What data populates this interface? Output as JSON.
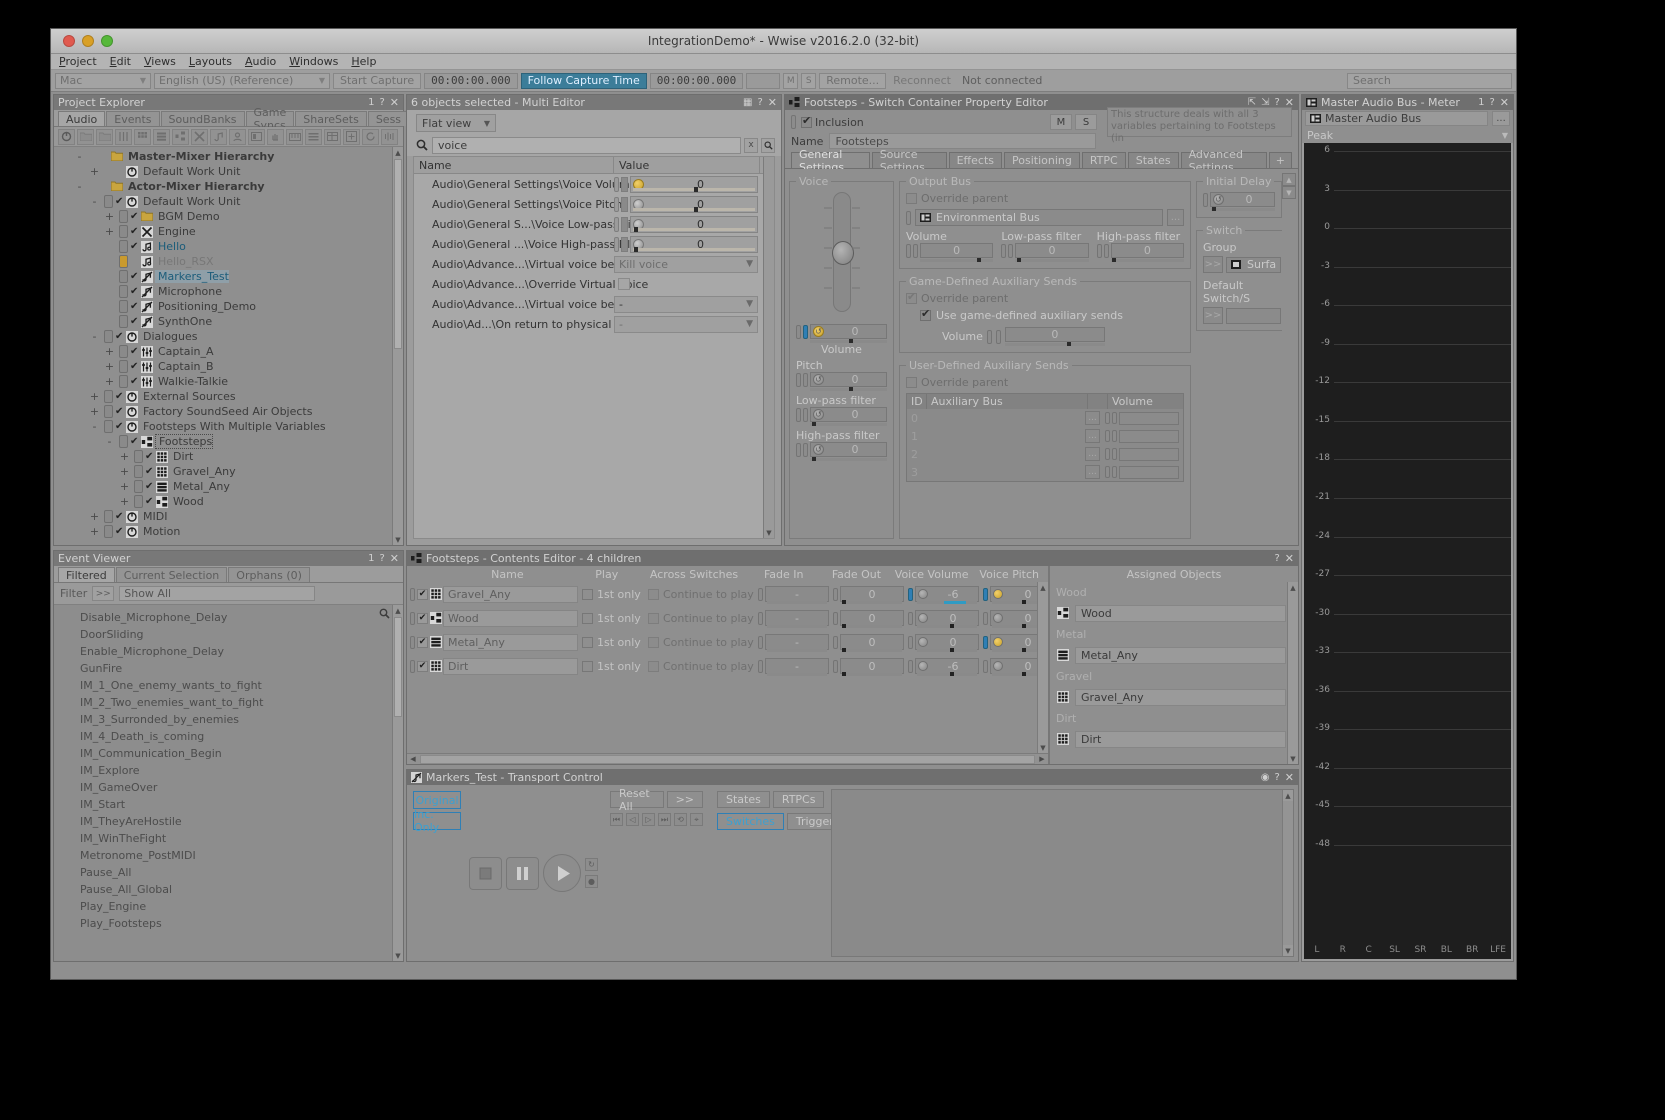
{
  "window": {
    "title": "IntegrationDemo* - Wwise v2016.2.0 (32-bit)"
  },
  "menubar": {
    "items": [
      "Project",
      "Edit",
      "Views",
      "Layouts",
      "Audio",
      "Windows",
      "Help"
    ]
  },
  "toolbar": {
    "platform": "Mac",
    "language": "English (US) (Reference)",
    "start_capture": "Start Capture",
    "time_1": "00:00:00.000",
    "follow_capture_time": "Follow Capture Time",
    "time_2": "00:00:00.000",
    "mute": "M",
    "solo": "S",
    "remote": "Remote...",
    "reconnect": "Reconnect",
    "status": "Not connected",
    "search_placeholder": "Search"
  },
  "project_explorer": {
    "title": "Project Explorer",
    "badge": "1",
    "tabs": [
      "Audio",
      "Events",
      "SoundBanks",
      "Game Syncs",
      "ShareSets",
      "Sess"
    ],
    "selected_tab": "Audio",
    "tree": [
      {
        "label": "Master-Mixer Hierarchy",
        "depth": 0,
        "expander": "-",
        "icon": "folder-icon",
        "style": "bold",
        "check": false
      },
      {
        "label": "Default Work Unit",
        "depth": 1,
        "expander": "+",
        "icon": "workunit-icon",
        "style": "normal",
        "check": false
      },
      {
        "label": "Actor-Mixer Hierarchy",
        "depth": 0,
        "expander": "-",
        "icon": "folder-icon",
        "style": "bold",
        "check": false
      },
      {
        "label": "Default Work Unit",
        "depth": 1,
        "expander": "-",
        "icon": "workunit-icon",
        "style": "normal",
        "check": true
      },
      {
        "label": "BGM Demo",
        "depth": 2,
        "expander": "+",
        "icon": "folder-icon",
        "style": "normal",
        "check": true
      },
      {
        "label": "Engine",
        "depth": 2,
        "expander": "+",
        "icon": "blend-icon",
        "style": "normal",
        "check": true
      },
      {
        "label": "Hello",
        "depth": 2,
        "expander": "",
        "icon": "sound-icon",
        "style": "blue",
        "check": true
      },
      {
        "label": "Hello_RSX",
        "depth": 2,
        "expander": "",
        "icon": "sound-icon",
        "style": "dim",
        "check": "amber"
      },
      {
        "label": "Markers_Test",
        "depth": 2,
        "expander": "",
        "icon": "music-icon",
        "style": "highlight",
        "check": true
      },
      {
        "label": "Microphone",
        "depth": 2,
        "expander": "",
        "icon": "music-icon",
        "style": "normal",
        "check": true
      },
      {
        "label": "Positioning_Demo",
        "depth": 2,
        "expander": "",
        "icon": "music-icon",
        "style": "normal",
        "check": true
      },
      {
        "label": "SynthOne",
        "depth": 2,
        "expander": "",
        "icon": "music-icon",
        "style": "normal",
        "check": true
      },
      {
        "label": "Dialogues",
        "depth": 1,
        "expander": "-",
        "icon": "workunit-icon",
        "style": "normal",
        "check": true
      },
      {
        "label": "Captain_A",
        "depth": 2,
        "expander": "+",
        "icon": "mixer-icon",
        "style": "normal",
        "check": true
      },
      {
        "label": "Captain_B",
        "depth": 2,
        "expander": "+",
        "icon": "mixer-icon",
        "style": "normal",
        "check": true
      },
      {
        "label": "Walkie-Talkie",
        "depth": 2,
        "expander": "+",
        "icon": "mixer-icon",
        "style": "normal",
        "check": true
      },
      {
        "label": "External Sources",
        "depth": 1,
        "expander": "+",
        "icon": "workunit-icon",
        "style": "normal",
        "check": true
      },
      {
        "label": "Factory SoundSeed Air Objects",
        "depth": 1,
        "expander": "+",
        "icon": "workunit-icon",
        "style": "normal",
        "check": true
      },
      {
        "label": "Footsteps With Multiple Variables",
        "depth": 1,
        "expander": "-",
        "icon": "workunit-icon",
        "style": "normal",
        "check": true
      },
      {
        "label": "Footsteps",
        "depth": 2,
        "expander": "-",
        "icon": "switch-icon",
        "style": "dashed",
        "check": true
      },
      {
        "label": "Dirt",
        "depth": 3,
        "expander": "+",
        "icon": "random-icon",
        "style": "normal",
        "check": true
      },
      {
        "label": "Gravel_Any",
        "depth": 3,
        "expander": "+",
        "icon": "random-icon",
        "style": "normal",
        "check": true
      },
      {
        "label": "Metal_Any",
        "depth": 3,
        "expander": "+",
        "icon": "seq-icon",
        "style": "normal",
        "check": true
      },
      {
        "label": "Wood",
        "depth": 3,
        "expander": "+",
        "icon": "switch-icon",
        "style": "normal",
        "check": true
      },
      {
        "label": "MIDI",
        "depth": 1,
        "expander": "+",
        "icon": "workunit-icon",
        "style": "normal",
        "check": true
      },
      {
        "label": "Motion",
        "depth": 1,
        "expander": "+",
        "icon": "workunit-icon",
        "style": "normal",
        "check": true
      }
    ]
  },
  "event_viewer": {
    "title": "Event Viewer",
    "badge": "1",
    "tabs": [
      "Filtered",
      "Current Selection",
      "Orphans (0)"
    ],
    "selected_tab": "Filtered",
    "filter_label": "Filter",
    "filter_button": ">>",
    "filter_value": "Show All",
    "items": [
      "Disable_Microphone_Delay",
      "DoorSliding",
      "Enable_Microphone_Delay",
      "GunFire",
      "IM_1_One_enemy_wants_to_fight",
      "IM_2_Two_enemies_want_to_fight",
      "IM_3_Surronded_by_enemies",
      "IM_4_Death_is_coming",
      "IM_Communication_Begin",
      "IM_Explore",
      "IM_GameOver",
      "IM_Start",
      "IM_TheyAreHostile",
      "IM_WinTheFight",
      "Metronome_PostMIDI",
      "Pause_All",
      "Pause_All_Global",
      "Play_Engine",
      "Play_Footsteps"
    ]
  },
  "multi_editor": {
    "title": "6 objects selected - Multi Editor",
    "view_mode": "Flat view",
    "search_value": "voice",
    "clear_button": "x",
    "columns": [
      "Name",
      "Value"
    ],
    "rows": [
      {
        "name": "Audio\\General Settings\\Voice Volume",
        "type": "slider",
        "value": "0",
        "reset_color": "amber",
        "knob_pct": 50
      },
      {
        "name": "Audio\\General Settings\\Voice Pitch",
        "type": "slider",
        "value": "0",
        "reset_color": "grey",
        "knob_pct": 50
      },
      {
        "name": "Audio\\General S...\\Voice Low-pass Filter",
        "type": "slider",
        "value": "0",
        "reset_color": "grey",
        "knob_pct": 2
      },
      {
        "name": "Audio\\General ...\\Voice High-pass Filter",
        "type": "slider",
        "value": "0",
        "reset_color": "grey",
        "knob_pct": 2
      },
      {
        "name": "Audio\\Advance...\\Virtual voice behavior",
        "type": "select-disabled",
        "value": "Kill voice"
      },
      {
        "name": "Audio\\Advance...\\Override Virtual Voice",
        "type": "checkbox",
        "value": ""
      },
      {
        "name": "Audio\\Advance...\\Virtual voice behavior",
        "type": "select",
        "value": "-"
      },
      {
        "name": "Audio\\Ad...\\On return to physical voice",
        "type": "select-disabled",
        "value": "-"
      }
    ]
  },
  "property_editor": {
    "title": "Footsteps - Switch Container Property Editor",
    "inclusion_label": "Inclusion",
    "mute": "M",
    "solo": "S",
    "note": "This structure deals with all 3 variables pertaining to Footsteps (in",
    "name_label": "Name",
    "name_value": "Footsteps",
    "tabs": [
      "General Settings",
      "Source Settings",
      "Effects",
      "Positioning",
      "RTPC",
      "States",
      "Advanced Settings"
    ],
    "selected_tab": "General Settings",
    "tab_plus": "+",
    "voice": {
      "legend": "Voice",
      "volume_label": "Volume",
      "volume_value": "0",
      "pitch_label": "Pitch",
      "pitch_value": "0",
      "lowpass_label": "Low-pass filter",
      "lowpass_value": "0",
      "highpass_label": "High-pass filter",
      "highpass_value": "0"
    },
    "output_bus": {
      "legend": "Output Bus",
      "override_parent": "Override parent",
      "bus_name": "Environmental Bus",
      "dots": "...",
      "volume_label": "Volume",
      "volume_value": "0",
      "lowpass_label": "Low-pass filter",
      "lowpass_value": "0",
      "highpass_label": "High-pass filter",
      "highpass_value": "0"
    },
    "game_aux": {
      "legend": "Game-Defined Auxiliary Sends",
      "override_parent": "Override parent",
      "use_label": "Use game-defined auxiliary sends",
      "volume_label": "Volume",
      "volume_value": "0"
    },
    "user_aux": {
      "legend": "User-Defined Auxiliary Sends",
      "override_parent": "Override parent",
      "columns": [
        "ID",
        "Auxiliary Bus",
        "Volume"
      ],
      "rows": [
        {
          "id": "0",
          "bus": "",
          "dots": "...",
          "volume": ""
        },
        {
          "id": "1",
          "bus": "",
          "dots": "...",
          "volume": ""
        },
        {
          "id": "2",
          "bus": "",
          "dots": "...",
          "volume": ""
        },
        {
          "id": "3",
          "bus": "",
          "dots": "...",
          "volume": ""
        }
      ]
    },
    "initial_delay": {
      "legend": "Initial Delay",
      "value": "0"
    },
    "switch": {
      "legend": "Switch",
      "group_label": "Group",
      "group_button": ">>",
      "group_value": "Surfa",
      "default_label": "Default Switch/S",
      "default_button": ">>",
      "default_value": ""
    }
  },
  "contents_editor": {
    "title": "Footsteps - Contents Editor - 4 children",
    "columns": [
      "Name",
      "Play",
      "Across Switches",
      "Fade In",
      "Fade Out",
      "Voice Volume",
      "Voice Pitch"
    ],
    "rows": [
      {
        "name": "Gravel_Any",
        "icon": "random-icon",
        "play": "1st only",
        "across": "Continue to play",
        "fade_in": "-",
        "fade_out": "0",
        "voice_volume": "-6",
        "voice_pitch": "0",
        "vol_highlight": true,
        "pitch_amber": true
      },
      {
        "name": "Wood",
        "icon": "switch-icon",
        "play": "1st only",
        "across": "Continue to play",
        "fade_in": "-",
        "fade_out": "0",
        "voice_volume": "0",
        "voice_pitch": "0",
        "vol_highlight": false,
        "pitch_amber": false
      },
      {
        "name": "Metal_Any",
        "icon": "seq-icon",
        "play": "1st only",
        "across": "Continue to play",
        "fade_in": "-",
        "fade_out": "0",
        "voice_volume": "0",
        "voice_pitch": "0",
        "vol_highlight": false,
        "pitch_amber": true
      },
      {
        "name": "Dirt",
        "icon": "random-icon",
        "play": "1st only",
        "across": "Continue to play",
        "fade_in": "-",
        "fade_out": "0",
        "voice_volume": "-6",
        "voice_pitch": "0",
        "vol_highlight": false,
        "pitch_amber": false
      }
    ],
    "assigned_objects": {
      "title": "Assigned Objects",
      "groups": [
        {
          "group": "Wood",
          "item": "Wood",
          "icon": "switch-icon"
        },
        {
          "group": "Metal",
          "item": "Metal_Any",
          "icon": "seq-icon"
        },
        {
          "group": "Gravel",
          "item": "Gravel_Any",
          "icon": "random-icon"
        },
        {
          "group": "Dirt",
          "item": "Dirt",
          "icon": "random-icon"
        }
      ]
    }
  },
  "transport": {
    "title": "Markers_Test - Transport Control",
    "original_label": "Original",
    "inc_only_label": "Inc. Only",
    "reset_all": "Reset All",
    "reset_more": ">>",
    "states": "States",
    "rtpcs": "RTPCs",
    "switches": "Switches",
    "triggers": "Triggers"
  },
  "meter": {
    "title": "Master Audio Bus - Meter",
    "badge": "1",
    "bus_name": "Master Audio Bus",
    "dots": "...",
    "mode": "Peak",
    "scale_labels": [
      "6",
      "3",
      "0",
      "-3",
      "-6",
      "-9",
      "-12",
      "-15",
      "-18",
      "-21",
      "-24",
      "-27",
      "-30",
      "-33",
      "-36",
      "-39",
      "-42",
      "-45",
      "-48"
    ],
    "channels": [
      "L",
      "R",
      "C",
      "SL",
      "SR",
      "BL",
      "BR",
      "LFE"
    ]
  },
  "colors": {
    "accent": "#2f7fb5",
    "amber": "#c8a12a",
    "panel": "#8f8f8f"
  }
}
